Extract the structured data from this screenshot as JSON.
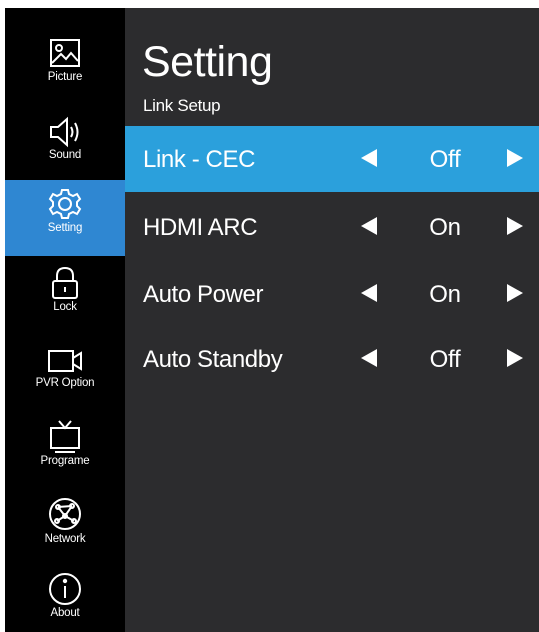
{
  "sidebar": {
    "items": [
      {
        "label": "Picture",
        "icon": "picture-icon",
        "active": false
      },
      {
        "label": "Sound",
        "icon": "speaker-icon",
        "active": false
      },
      {
        "label": "Setting",
        "icon": "gear-icon",
        "active": true
      },
      {
        "label": "Lock",
        "icon": "lock-icon",
        "active": false
      },
      {
        "label": "PVR Option",
        "icon": "video-camera-icon",
        "active": false
      },
      {
        "label": "Programe",
        "icon": "tv-icon",
        "active": false
      },
      {
        "label": "Network",
        "icon": "globe-icon",
        "active": false
      },
      {
        "label": "About",
        "icon": "info-icon",
        "active": false
      }
    ]
  },
  "header": {
    "title": "Setting",
    "subtitle": "Link Setup"
  },
  "settings": [
    {
      "label": "Link - CEC",
      "value": "Off",
      "selected": true
    },
    {
      "label": "HDMI ARC",
      "value": "On",
      "selected": false
    },
    {
      "label": "Auto Power",
      "value": "On",
      "selected": false
    },
    {
      "label": "Auto Standby",
      "value": "Off",
      "selected": false
    }
  ],
  "colors": {
    "sidebar_bg": "#000000",
    "sidebar_active": "#2f87d2",
    "panel_bg": "#2c2c2e",
    "row_highlight": "#2ba0dc"
  }
}
